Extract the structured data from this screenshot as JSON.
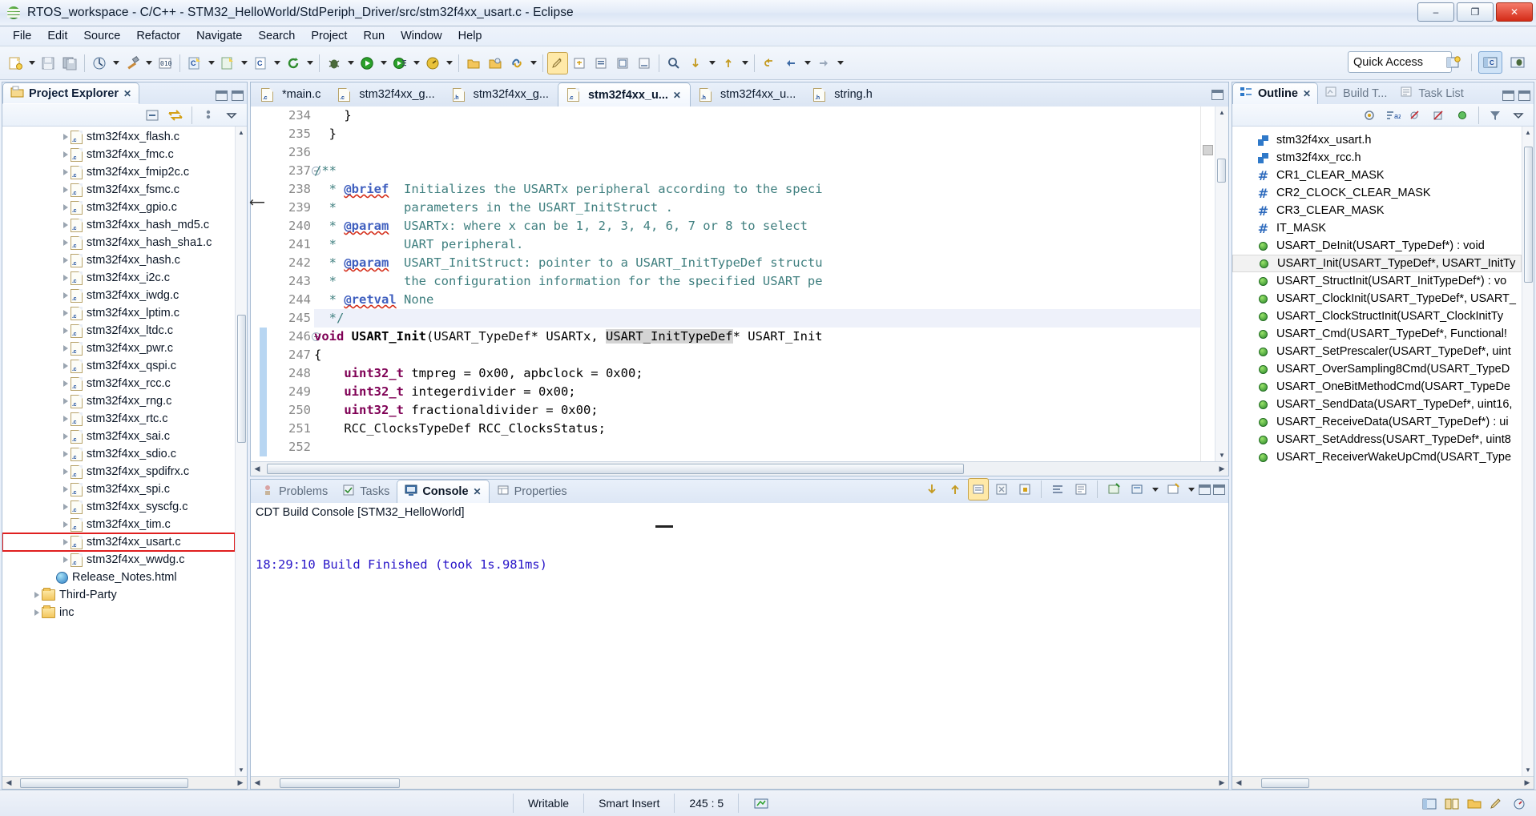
{
  "window": {
    "title": "RTOS_workspace - C/C++ - STM32_HelloWorld/StdPeriph_Driver/src/stm32f4xx_usart.c - Eclipse",
    "app_icon": "eclipse-icon",
    "minimize": "–",
    "maximize": "❐",
    "close": "✕"
  },
  "menu": [
    {
      "label": "File"
    },
    {
      "label": "Edit"
    },
    {
      "label": "Source"
    },
    {
      "label": "Refactor"
    },
    {
      "label": "Navigate"
    },
    {
      "label": "Search"
    },
    {
      "label": "Project"
    },
    {
      "label": "Run"
    },
    {
      "label": "Window"
    },
    {
      "label": "Help"
    }
  ],
  "toolbar": {
    "quick_access": "Quick Access",
    "items": [
      "new-wizard-icon",
      "save-icon",
      "save-all-icon",
      "build-all-icon",
      "build-hammer-icon",
      "binary-icon",
      "new-c-project-icon",
      "new-cpp-project-icon",
      "new-c-file-icon",
      "refresh-icon",
      "debug-bug-icon",
      "run-icon",
      "external-tools-icon",
      "search-icon",
      "open-folder-icon",
      "open-type-icon",
      "link-icon",
      "edit-pencil-icon",
      "next-annotation-icon",
      "prev-annotation-icon",
      "toggle-mark-icon",
      "toggle-block-icon",
      "toggle-breakpoint-icon",
      "skip-all-breakpoints-icon",
      "next-edit-icon",
      "prev-edit-icon",
      "back-icon",
      "forward-icon"
    ],
    "perspective": [
      "open-perspective-icon",
      "cpp-perspective-icon",
      "debug-perspective-icon"
    ]
  },
  "project_explorer": {
    "tab_label": "Project Explorer",
    "close_glyph": "✕",
    "toolbar_icons": [
      "collapse-all-icon",
      "link-with-editor-icon",
      "view-menu-icon"
    ],
    "items": [
      {
        "label": "stm32f4xx_flash.c",
        "type": "c",
        "indent": 3,
        "selected": false
      },
      {
        "label": "stm32f4xx_fmc.c",
        "type": "c",
        "indent": 3,
        "selected": false
      },
      {
        "label": "stm32f4xx_fmip2c.c",
        "type": "c",
        "indent": 3,
        "selected": false
      },
      {
        "label": "stm32f4xx_fsmc.c",
        "type": "c",
        "indent": 3,
        "selected": false
      },
      {
        "label": "stm32f4xx_gpio.c",
        "type": "c",
        "indent": 3,
        "selected": false
      },
      {
        "label": "stm32f4xx_hash_md5.c",
        "type": "c",
        "indent": 3,
        "selected": false
      },
      {
        "label": "stm32f4xx_hash_sha1.c",
        "type": "c",
        "indent": 3,
        "selected": false
      },
      {
        "label": "stm32f4xx_hash.c",
        "type": "c",
        "indent": 3,
        "selected": false
      },
      {
        "label": "stm32f4xx_i2c.c",
        "type": "c",
        "indent": 3,
        "selected": false
      },
      {
        "label": "stm32f4xx_iwdg.c",
        "type": "c",
        "indent": 3,
        "selected": false
      },
      {
        "label": "stm32f4xx_lptim.c",
        "type": "c",
        "indent": 3,
        "selected": false
      },
      {
        "label": "stm32f4xx_ltdc.c",
        "type": "c",
        "indent": 3,
        "selected": false
      },
      {
        "label": "stm32f4xx_pwr.c",
        "type": "c",
        "indent": 3,
        "selected": false
      },
      {
        "label": "stm32f4xx_qspi.c",
        "type": "c",
        "indent": 3,
        "selected": false
      },
      {
        "label": "stm32f4xx_rcc.c",
        "type": "c",
        "indent": 3,
        "selected": false
      },
      {
        "label": "stm32f4xx_rng.c",
        "type": "c",
        "indent": 3,
        "selected": false
      },
      {
        "label": "stm32f4xx_rtc.c",
        "type": "c",
        "indent": 3,
        "selected": false
      },
      {
        "label": "stm32f4xx_sai.c",
        "type": "c",
        "indent": 3,
        "selected": false
      },
      {
        "label": "stm32f4xx_sdio.c",
        "type": "c",
        "indent": 3,
        "selected": false
      },
      {
        "label": "stm32f4xx_spdifrx.c",
        "type": "c",
        "indent": 3,
        "selected": false
      },
      {
        "label": "stm32f4xx_spi.c",
        "type": "c",
        "indent": 3,
        "selected": false
      },
      {
        "label": "stm32f4xx_syscfg.c",
        "type": "c",
        "indent": 3,
        "selected": false
      },
      {
        "label": "stm32f4xx_tim.c",
        "type": "c",
        "indent": 3,
        "selected": false
      },
      {
        "label": "stm32f4xx_usart.c",
        "type": "c",
        "indent": 3,
        "selected": true
      },
      {
        "label": "stm32f4xx_wwdg.c",
        "type": "c",
        "indent": 3,
        "selected": false
      },
      {
        "label": "Release_Notes.html",
        "type": "html",
        "indent": 2,
        "selected": false
      },
      {
        "label": "Third-Party",
        "type": "folder",
        "indent": 1,
        "selected": false
      },
      {
        "label": "inc",
        "type": "folder",
        "indent": 1,
        "selected": false
      }
    ]
  },
  "editor": {
    "tabs": [
      {
        "label": "*main.c",
        "icon": "c-file-icon",
        "active": false,
        "dirty": true
      },
      {
        "label": "stm32f4xx_g...",
        "icon": "c-file-icon",
        "active": false
      },
      {
        "label": "stm32f4xx_g...",
        "icon": "h-file-icon",
        "active": false
      },
      {
        "label": "stm32f4xx_u...",
        "icon": "c-file-icon",
        "active": true
      },
      {
        "label": "stm32f4xx_u...",
        "icon": "h-file-icon",
        "active": false
      },
      {
        "label": "string.h",
        "icon": "h-file-icon",
        "active": false
      }
    ],
    "first_line": 234,
    "lines": [
      {
        "n": 234,
        "text": "    }"
      },
      {
        "n": 235,
        "text": "  }"
      },
      {
        "n": 236,
        "text": ""
      },
      {
        "n": 237,
        "text": "/**",
        "fold": true
      },
      {
        "n": 238,
        "text": "  * @brief  Initializes the USARTx peripheral according to the speci"
      },
      {
        "n": 239,
        "text": "  *         parameters in the USART_InitStruct ."
      },
      {
        "n": 240,
        "text": "  * @param  USARTx: where x can be 1, 2, 3, 4, 6, 7 or 8 to select"
      },
      {
        "n": 241,
        "text": "  *         UART peripheral."
      },
      {
        "n": 242,
        "text": "  * @param  USART_InitStruct: pointer to a USART_InitTypeDef structu"
      },
      {
        "n": 243,
        "text": "  *         the configuration information for the specified USART pe"
      },
      {
        "n": 244,
        "text": "  * @retval None"
      },
      {
        "n": 245,
        "text": "  */",
        "highlight": true
      },
      {
        "n": 246,
        "text": "void USART_Init(USART_TypeDef* USARTx, USART_InitTypeDef* USART_Init",
        "fold": true
      },
      {
        "n": 247,
        "text": "{"
      },
      {
        "n": 248,
        "text": "    uint32_t tmpreg = 0x00, apbclock = 0x00;"
      },
      {
        "n": 249,
        "text": "    uint32_t integerdivider = 0x00;"
      },
      {
        "n": 250,
        "text": "    uint32_t fractionaldivider = 0x00;"
      },
      {
        "n": 251,
        "text": "    RCC_ClocksTypeDef RCC_ClocksStatus;"
      },
      {
        "n": 252,
        "text": ""
      }
    ]
  },
  "console": {
    "tabs": [
      {
        "label": "Problems",
        "icon": "problems-icon",
        "active": false
      },
      {
        "label": "Tasks",
        "icon": "tasks-icon",
        "active": false
      },
      {
        "label": "Console",
        "icon": "console-icon",
        "active": true,
        "close_glyph": "✕"
      },
      {
        "label": "Properties",
        "icon": "properties-icon",
        "active": false
      }
    ],
    "toolbar_icons": [
      "scroll-down-icon",
      "scroll-up-icon",
      "scroll-lock-icon",
      "clear-console-icon",
      "lock-console-icon",
      "word-wrap-icon",
      "show-console-icon",
      "pin-console-icon",
      "display-selected-console-icon",
      "open-console-icon",
      "minimize-icon",
      "maximize-icon"
    ],
    "title": "CDT Build Console [STM32_HelloWorld]",
    "output": "18:29:10 Build Finished (took 1s.981ms)"
  },
  "outline": {
    "tabs": [
      {
        "label": "Outline",
        "icon": "outline-icon",
        "active": true,
        "close_glyph": "✕"
      },
      {
        "label": "Build T...",
        "icon": "build-targets-icon",
        "active": false
      },
      {
        "label": "Task List",
        "icon": "task-list-icon",
        "active": false
      }
    ],
    "toolbar_icons": [
      "focus-active-task-icon",
      "sort-icon",
      "hide-fields-icon",
      "hide-static-icon",
      "hide-nonpublic-icon",
      "filter-icon",
      "view-menu-icon"
    ],
    "items": [
      {
        "label": "stm32f4xx_usart.h",
        "icon": "include-icon",
        "selected": false
      },
      {
        "label": "stm32f4xx_rcc.h",
        "icon": "include-icon",
        "selected": false
      },
      {
        "label": "CR1_CLEAR_MASK",
        "icon": "macro-icon",
        "selected": false
      },
      {
        "label": "CR2_CLOCK_CLEAR_MASK",
        "icon": "macro-icon",
        "selected": false
      },
      {
        "label": "CR3_CLEAR_MASK",
        "icon": "macro-icon",
        "selected": false
      },
      {
        "label": "IT_MASK",
        "icon": "macro-icon",
        "selected": false
      },
      {
        "label": "USART_DeInit(USART_TypeDef*) : void",
        "icon": "function-icon",
        "selected": false
      },
      {
        "label": "USART_Init(USART_TypeDef*, USART_InitTy",
        "icon": "function-icon",
        "selected": true
      },
      {
        "label": "USART_StructInit(USART_InitTypeDef*) : vo",
        "icon": "function-icon",
        "selected": false
      },
      {
        "label": "USART_ClockInit(USART_TypeDef*, USART_",
        "icon": "function-icon",
        "selected": false
      },
      {
        "label": "USART_ClockStructInit(USART_ClockInitTy",
        "icon": "function-icon",
        "selected": false
      },
      {
        "label": "USART_Cmd(USART_TypeDef*, Functional!",
        "icon": "function-icon",
        "selected": false
      },
      {
        "label": "USART_SetPrescaler(USART_TypeDef*, uint",
        "icon": "function-icon",
        "selected": false
      },
      {
        "label": "USART_OverSampling8Cmd(USART_TypeD",
        "icon": "function-icon",
        "selected": false
      },
      {
        "label": "USART_OneBitMethodCmd(USART_TypeDe",
        "icon": "function-icon",
        "selected": false
      },
      {
        "label": "USART_SendData(USART_TypeDef*, uint16,",
        "icon": "function-icon",
        "selected": false
      },
      {
        "label": "USART_ReceiveData(USART_TypeDef*) : ui",
        "icon": "function-icon",
        "selected": false
      },
      {
        "label": "USART_SetAddress(USART_TypeDef*, uint8",
        "icon": "function-icon",
        "selected": false
      },
      {
        "label": "USART_ReceiverWakeUpCmd(USART_Type",
        "icon": "function-icon",
        "selected": false
      }
    ]
  },
  "statusbar": {
    "writable": "Writable",
    "insert_mode": "Smart Insert",
    "position": "245 : 5",
    "icons": [
      "build-status-icon",
      "perspective-icon",
      "book-icon",
      "folder-icon",
      "pencil-icon",
      "gauge-icon"
    ]
  }
}
